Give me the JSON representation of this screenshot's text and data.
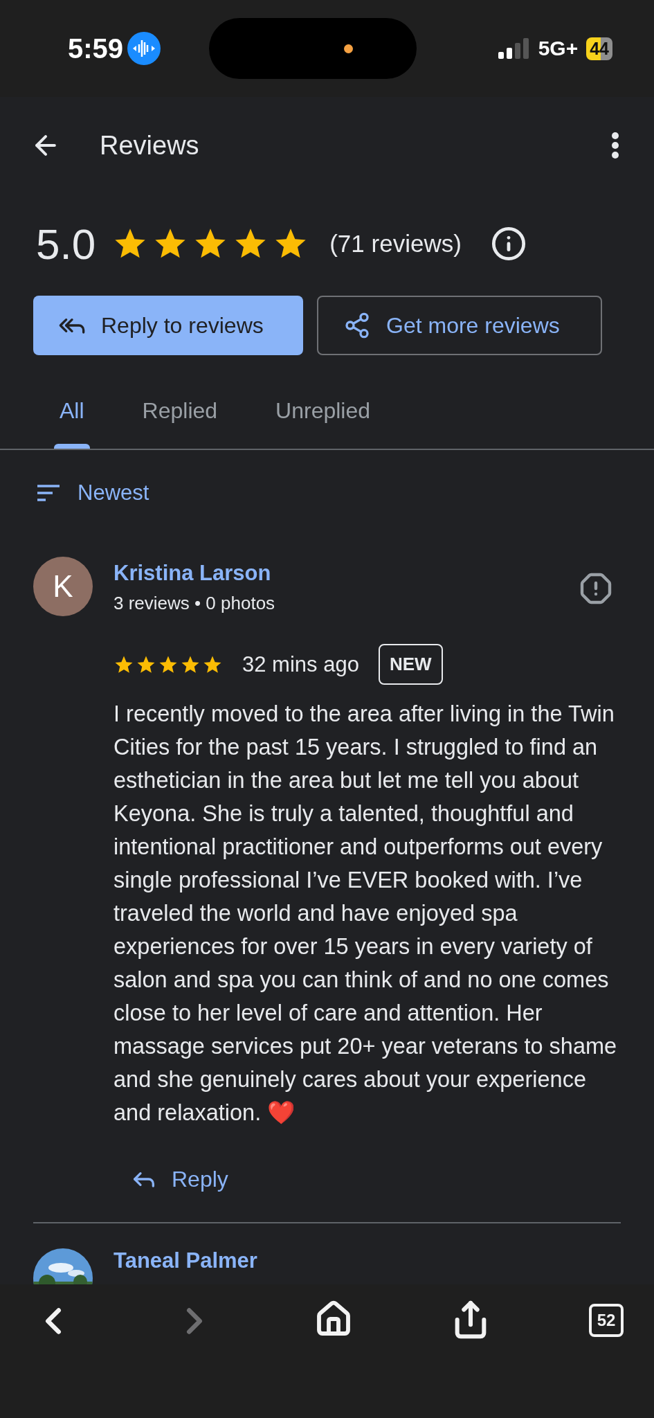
{
  "status_bar": {
    "time": "5:59",
    "network": "5G+",
    "battery": "44"
  },
  "header": {
    "title": "Reviews"
  },
  "summary": {
    "rating": "5.0",
    "stars": 5,
    "count": "(71 reviews)"
  },
  "actions": [
    {
      "kind": "primary",
      "label": "Reply to reviews"
    },
    {
      "kind": "outline",
      "label": "Get more reviews"
    }
  ],
  "tabs": [
    {
      "label": "All",
      "selected": true
    },
    {
      "label": "Replied",
      "selected": false
    },
    {
      "label": "Unreplied",
      "selected": false
    }
  ],
  "sort": {
    "label": "Newest"
  },
  "reviews": [
    {
      "initial": "K",
      "name": "Kristina Larson",
      "meta": "3 reviews • 0 photos",
      "stars": 5,
      "time": "32 mins ago",
      "badge": "NEW",
      "text": "I recently moved to the area after living in the Twin Cities for the past 15 years. I struggled to find an esthetician in the area but let me tell you about Keyona. She is truly a talented, thoughtful and intentional practitioner and outperforms out every single professional I’ve EVER booked with. I’ve traveled the world and have enjoyed spa experiences for over 15 years in every variety of salon and spa you can think of and no one comes close to her level of care and attention. Her massage services put 20+ year veterans to shame and she genuinely cares about your experience and relaxation. ❤️",
      "reply": "Reply"
    },
    {
      "kind": "picture",
      "name": "Taneal Palmer"
    }
  ],
  "browser_bar": [
    {
      "kind": "back",
      "disabled": false
    },
    {
      "kind": "forward",
      "disabled": true
    },
    {
      "kind": "home",
      "disabled": false
    },
    {
      "kind": "share",
      "disabled": false
    },
    {
      "kind": "tabs",
      "label": "52"
    }
  ]
}
